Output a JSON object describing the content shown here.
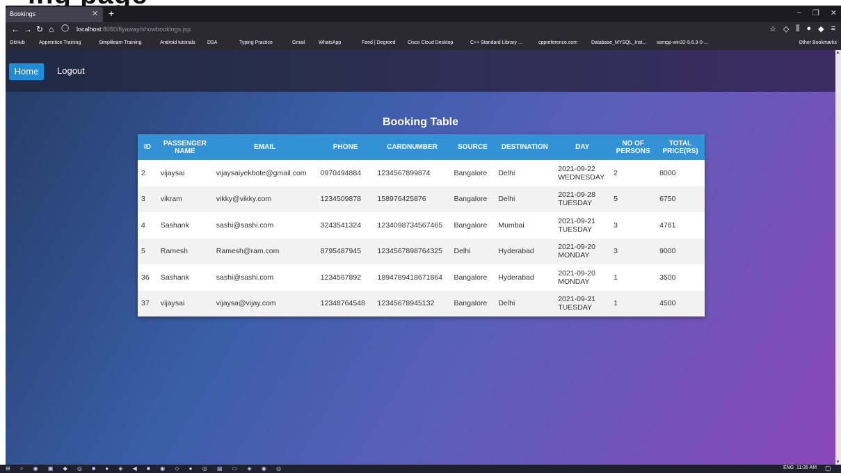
{
  "header_fragment": "ing page",
  "browser": {
    "tab_title": "Bookings",
    "url_host": "localhost",
    "url_path": ":8080/flyaway/showbookings.jsp",
    "bookmarks": [
      "GitHub",
      "Apprentice Training",
      "Simplilearn Training",
      "Android tutorials",
      "DSA",
      "Typing Practice",
      "Gmail",
      "WhatsApp",
      "Feed | Degreed",
      "Cisco Cloud Desktop",
      "C++ Standard Library ...",
      "cppreference.com",
      "Database_MYSQL_Inst...",
      "xampp-win32-5.6.3-0-..."
    ],
    "other_bookmarks": "Other Bookmarks"
  },
  "nav": {
    "home": "Home",
    "logout": "Logout"
  },
  "table": {
    "title": "Booking Table",
    "headers": [
      "ID",
      "PASSENGER NAME",
      "EMAIL",
      "PHONE",
      "CARDNUMBER",
      "SOURCE",
      "DESTINATION",
      "DAY",
      "NO OF PERSONS",
      "TOTAL PRICE(RS)"
    ],
    "rows": [
      [
        "2",
        "vijaysai",
        "vijaysaiyekbote@gmail.com",
        "0970494884",
        "1234567899874",
        "Bangalore",
        "Delhi",
        "2021-09-22 WEDNESDAY",
        "2",
        "8000"
      ],
      [
        "3",
        "vikram",
        "vikky@vikky.com",
        "1234509878",
        "158976425876",
        "Bangalore",
        "Delhi",
        "2021-09-28 TUESDAY",
        "5",
        "6750"
      ],
      [
        "4",
        "Sashank",
        "sashi@sashi.com",
        "3243541324",
        "1234098734567465",
        "Bangalore",
        "Mumbai",
        "2021-09-21 TUESDAY",
        "3",
        "4761"
      ],
      [
        "5",
        "Ramesh",
        "Ramesh@ram.com",
        "8795487945",
        "1234567898764325",
        "Delhi",
        "Hyderabad",
        "2021-09-20 MONDAY",
        "3",
        "9000"
      ],
      [
        "36",
        "Sashank",
        "sashi@sashi.com",
        "1234567892",
        "1894789418671864",
        "Bangalore",
        "Hyderabad",
        "2021-09-20 MONDAY",
        "1",
        "3500"
      ],
      [
        "37",
        "vijaysai",
        "vijaysa@vijay.com",
        "12348764548",
        "12345678945132",
        "Bangalore",
        "Delhi",
        "2021-09-21 TUESDAY",
        "1",
        "4500"
      ]
    ]
  },
  "taskbar": {
    "lang": "ENG",
    "time": "11:35 AM"
  },
  "colors": {
    "home_button": "#1d8cd9",
    "table_header": "#3392d6"
  }
}
